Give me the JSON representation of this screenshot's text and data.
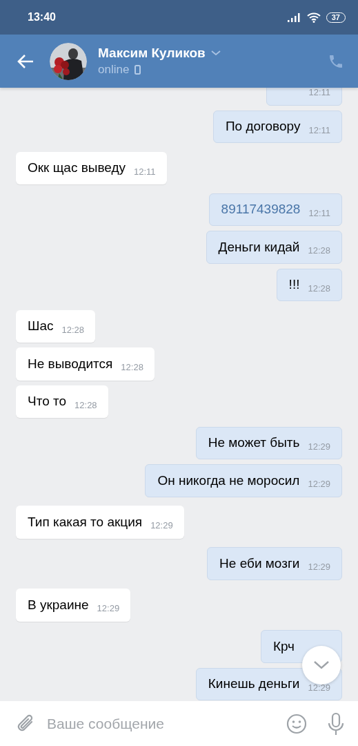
{
  "status_bar": {
    "time": "13:40",
    "battery": "37"
  },
  "header": {
    "name": "Максим Куликов",
    "status": "online"
  },
  "messages": [
    {
      "kind": "out",
      "time": "12:11"
    },
    {
      "kind": "out",
      "text": "По договору",
      "time": "12:11"
    },
    {
      "kind": "in",
      "text": "Окк щас выведу",
      "time": "12:11"
    },
    {
      "kind": "out",
      "text": "89117439828",
      "time": "12:11",
      "link": true
    },
    {
      "kind": "out",
      "text": "Деньги кидай",
      "time": "12:28"
    },
    {
      "kind": "out",
      "text": "!!!",
      "time": "12:28"
    },
    {
      "kind": "in",
      "text": "Шас",
      "time": "12:28"
    },
    {
      "kind": "in",
      "text": "Не выводится",
      "time": "12:28"
    },
    {
      "kind": "in",
      "text": "Что то",
      "time": "12:28"
    },
    {
      "kind": "out",
      "text": "Не может быть",
      "time": "12:29"
    },
    {
      "kind": "out",
      "text": "Он никогда не моросил",
      "time": "12:29"
    },
    {
      "kind": "in",
      "text": "Тип какая то акция",
      "time": "12:29"
    },
    {
      "kind": "out",
      "text": "Не еби мозги",
      "time": "12:29"
    },
    {
      "kind": "in",
      "text": "В украине",
      "time": "12:29"
    },
    {
      "kind": "out",
      "text": "Крч"
    },
    {
      "kind": "out",
      "text": "Кинешь деньги",
      "time": "12:29"
    }
  ],
  "input": {
    "placeholder": "Ваше сообщение"
  }
}
